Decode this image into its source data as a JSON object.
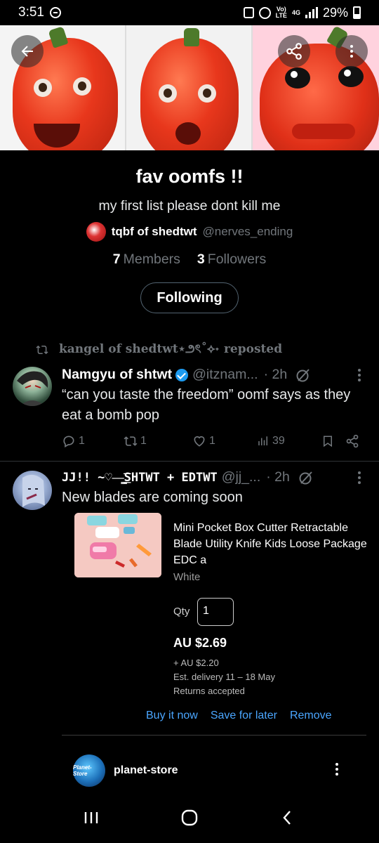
{
  "status_bar": {
    "time": "3:51",
    "network": "4G",
    "battery": "29%"
  },
  "list": {
    "title": "fav oomfs !!",
    "description": "my first list please dont kill me",
    "owner_name": "tqbf of shedtwt",
    "owner_handle": "@nerves_ending",
    "members_count": "7",
    "members_label": "Members",
    "followers_count": "3",
    "followers_label": "Followers",
    "following_button": "Following"
  },
  "repost": {
    "text": "kangel of shedtwt⋆౨ৎ˚⟡˖ reposted"
  },
  "tweets": [
    {
      "name": "Namgyu of shtwt",
      "handle": "@itznam...",
      "time": "· 2h",
      "text": "“can you taste the freedom” oomf says as they eat a bomb pop",
      "replies": "1",
      "reposts": "1",
      "likes": "1",
      "views": "39"
    },
    {
      "name": "JJ!! ~♡—̳͟͞͞SHTWT + EDTWT",
      "handle": "@jj_...",
      "time": "· 2h",
      "text": "New blades are coming soon"
    }
  ],
  "product": {
    "title": "Mini Pocket Box Cutter Retractable Blade Utility Knife Kids Loose Package  EDC a",
    "variant": "White",
    "qty_label": "Qty",
    "qty_value": "1",
    "price": "AU $2.69",
    "postage": "+ AU $2.20",
    "delivery": "Est. delivery 11 – 18 May",
    "returns": "Returns accepted",
    "buy_now": "Buy it now",
    "save_later": "Save for later",
    "remove": "Remove",
    "store_name": "planet-store",
    "store_logo_text": "Planet-Store"
  },
  "colors": {
    "accent": "#1d9bf0",
    "link": "#4aa6ff",
    "muted": "#71767b"
  }
}
